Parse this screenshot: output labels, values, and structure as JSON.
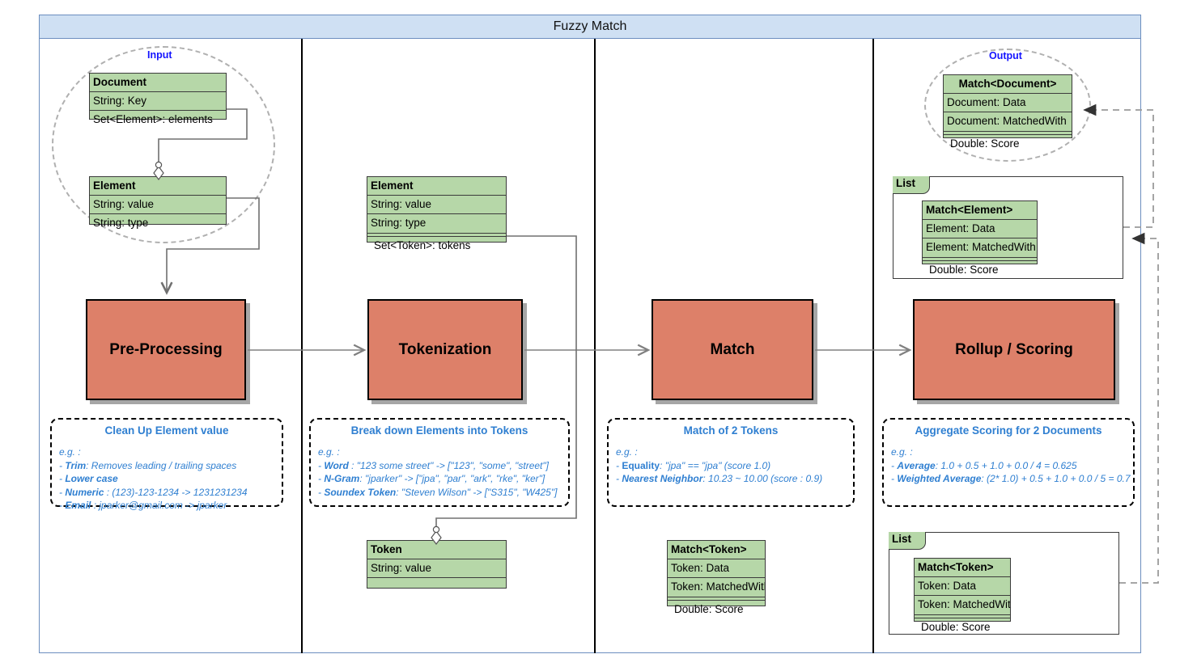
{
  "diagram": {
    "title": "Fuzzy Match",
    "colors": {
      "title_bar": "#cfe0f3",
      "class_fill": "#b6d7a8",
      "process_fill": "#dd8069",
      "note_text": "#2f7fd1",
      "group_label": "#1414ff",
      "ellipse_stroke": "#b0b0b0"
    }
  },
  "groups": {
    "input_label": "Input",
    "output_label": "Output"
  },
  "classes": {
    "document": {
      "header": "Document",
      "rows": [
        "String: Key",
        "Set<Element>: elements"
      ]
    },
    "element_input": {
      "header": "Element",
      "rows": [
        "String: value",
        "String: type"
      ]
    },
    "element_tokenized": {
      "header": "Element",
      "rows": [
        "String: value",
        "String: type",
        "Set<Token>: tokens"
      ]
    },
    "token": {
      "header": "Token",
      "rows": [
        "String: value",
        ""
      ]
    },
    "match_document": {
      "header": "Match<Document>",
      "rows": [
        "Document: Data",
        "Document: MatchedWith",
        "Double: Score"
      ]
    },
    "match_element": {
      "header": "Match<Element>",
      "rows": [
        "Element: Data",
        "Element: MatchedWith",
        "Double: Score"
      ]
    },
    "match_token_col3": {
      "header": "Match<Token>",
      "rows": [
        "Token: Data",
        "Token: MatchedWith",
        "Double: Score"
      ]
    },
    "match_token_col4": {
      "header": "Match<Token>",
      "rows": [
        "Token: Data",
        "Token: MatchedWith",
        "Double: Score"
      ]
    },
    "list_label_top": "List",
    "list_label_bottom": "List"
  },
  "processes": {
    "p1": "Pre-Processing",
    "p2": "Tokenization",
    "p3": "Match",
    "p4": "Rollup / Scoring"
  },
  "notes": {
    "n1": {
      "title": "Clean Up Element value",
      "lines": [
        {
          "prefix": "e.g. :",
          "bold": "",
          "rest": ""
        },
        {
          "prefix": "- ",
          "bold": "Trim",
          "rest": ": Removes leading / trailing spaces"
        },
        {
          "prefix": "- ",
          "bold": "Lower case",
          "rest": ""
        },
        {
          "prefix": "- ",
          "bold": "Numeric",
          "rest": " : (123)-123-1234 -> 1231231234"
        },
        {
          "prefix": "- ",
          "bold": "Email",
          "rest": " : jparker@gmail.com -> jparker"
        }
      ]
    },
    "n2": {
      "title": "Break down Elements into Tokens",
      "lines": [
        {
          "prefix": "e.g. :",
          "bold": "",
          "rest": ""
        },
        {
          "prefix": "- ",
          "bold": "Word",
          "rest": " : \"123 some street\" -> [\"123\", \"some\", \"street\"]"
        },
        {
          "prefix": "- ",
          "bold": "N-Gram",
          "rest": ": \"jparker\" -> [\"jpa\", \"par\", \"ark\", \"rke\", \"ker\"]"
        },
        {
          "prefix": "- ",
          "bold": "Soundex Token",
          "rest": ": \"Steven Wilson\" ->  [\"S315\", \"W425\"]"
        }
      ]
    },
    "n3": {
      "title": "Match of 2 Tokens",
      "lines": [
        {
          "prefix": "e.g. :",
          "bold": "",
          "rest": ""
        },
        {
          "prefix": "- ",
          "bold": "Equality",
          "rest": ": \"jpa\" == \"jpa\" (score 1.0)",
          "upright": true
        },
        {
          "prefix": "- ",
          "bold": "Nearest Neighbor",
          "rest": ": 10.23 ~ 10.00 (score : 0.9)"
        }
      ]
    },
    "n4": {
      "title": "Aggregate Scoring for 2 Documents",
      "lines": [
        {
          "prefix": "e.g. :",
          "bold": "",
          "rest": ""
        },
        {
          "prefix": "- ",
          "bold": "Average",
          "rest": ":  1.0 + 0.5 + 1.0 + 0.0 / 4 = 0.625"
        },
        {
          "prefix": "- ",
          "bold": "Weighted Average",
          "rest": ": (2* 1.0) + 0.5 + 1.0 + 0.0 / 5 = 0.7"
        }
      ]
    }
  }
}
